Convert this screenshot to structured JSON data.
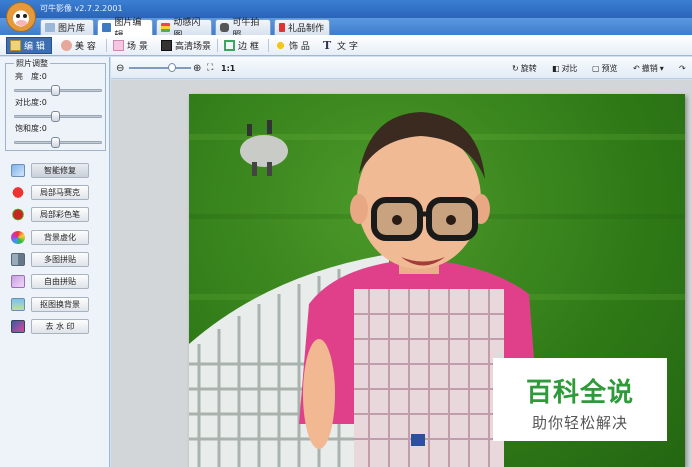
{
  "app": {
    "title": "可牛影像  v2.7.2.2001"
  },
  "main_tabs": [
    {
      "label": "图片库"
    },
    {
      "label": "图片编辑"
    },
    {
      "label": "动感闪图"
    },
    {
      "label": "可牛拍照"
    },
    {
      "label": "礼品制作"
    }
  ],
  "sub_tools": [
    {
      "label": "编 辑"
    },
    {
      "label": "美 容"
    },
    {
      "label": "场 景"
    },
    {
      "label": "高清场景"
    },
    {
      "label": "边 框"
    },
    {
      "label": "饰 品"
    },
    {
      "label": "文 字"
    }
  ],
  "adjust": {
    "legend": "照片调整",
    "sliders": [
      {
        "label": "亮　度:",
        "value": "0",
        "level": 0.45
      },
      {
        "label": "对比度:",
        "value": "0",
        "level": 0.45
      },
      {
        "label": "饱和度:",
        "value": "0",
        "level": 0.45
      }
    ]
  },
  "tools": [
    {
      "label": "智能修复"
    },
    {
      "label": "局部马赛克"
    },
    {
      "label": "局部彩色笔"
    },
    {
      "label": "背景虚化"
    },
    {
      "label": "多图拼贴"
    },
    {
      "label": "自由拼贴"
    },
    {
      "label": "抠图换背景"
    },
    {
      "label": "去 水 印"
    }
  ],
  "view": {
    "zoom_label": "1:1",
    "zoom_level": 0.7,
    "rotate": "旋转",
    "compare": "对比",
    "preview": "预览",
    "undo": "撤销"
  },
  "watermark": {
    "main": "百科全说",
    "sub": "助你轻松解决"
  },
  "colors": {
    "accent": "#3d6fb0",
    "watermark_green": "#2f9a3a"
  }
}
